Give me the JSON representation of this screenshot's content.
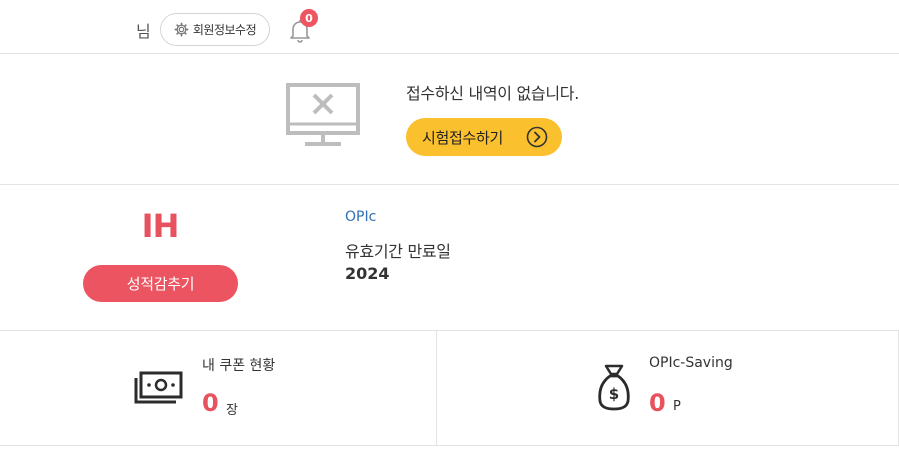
{
  "header": {
    "user_suffix": "님",
    "edit_profile_label": "회원정보수정",
    "notification_count": "0"
  },
  "application": {
    "empty_message": "접수하신 내역이 없습니다.",
    "apply_button_label": "시험접수하기"
  },
  "grade": {
    "value": "IH",
    "button_label": "성적감추기",
    "exam_name": "OPIc",
    "expiry_label": "유효기간 만료일",
    "expiry_date": "2024.("
  },
  "coupon": {
    "title": "내 쿠폰 현황",
    "count": "0",
    "unit": "장"
  },
  "saving": {
    "title": "OPIc-Saving",
    "count": "0",
    "unit": "P"
  },
  "colors": {
    "accent_yellow": "#fbc02d",
    "accent_red": "#ec5461",
    "link_blue": "#2e6fb6"
  }
}
